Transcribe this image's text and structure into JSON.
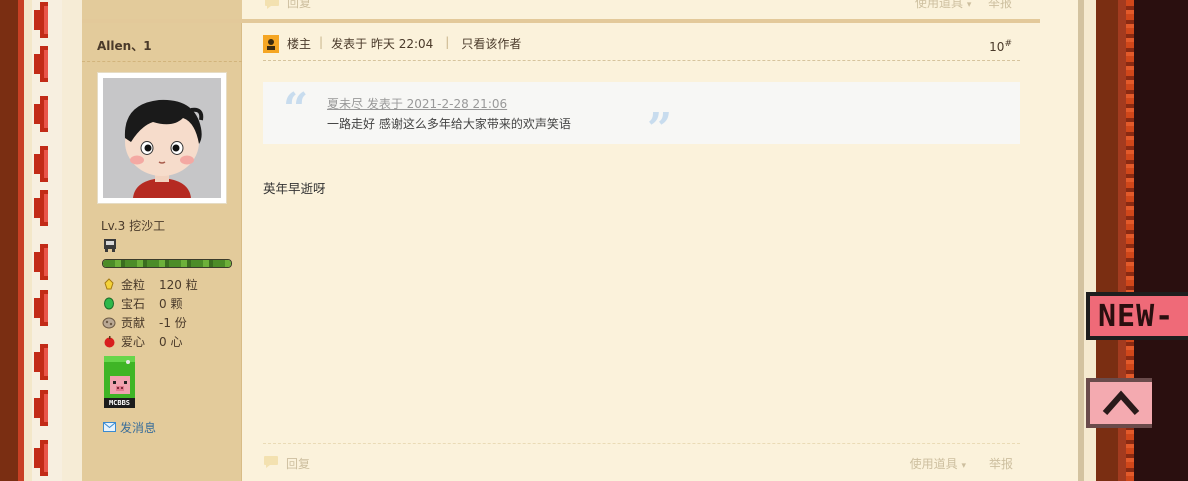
{
  "top_bar": {
    "reply_label": "回复",
    "tools_label": "使用道具",
    "report_label": "举报"
  },
  "author": {
    "username": "Allen、1",
    "level_text": "Lv.3 挖沙工",
    "exp_fraction": 1.0,
    "stats": [
      {
        "icon": "gold-nugget-icon",
        "label": "金粒",
        "value": "120 粒"
      },
      {
        "icon": "emerald-icon",
        "label": "宝石",
        "value": "0 颗"
      },
      {
        "icon": "contribution-icon",
        "label": "贡献",
        "value": "-1 份"
      },
      {
        "icon": "apple-icon",
        "label": "爱心",
        "value": "0 心"
      }
    ],
    "badge_text": "MCBBS",
    "send_message_label": "发消息"
  },
  "post": {
    "author_role": "楼主",
    "posted_at": "发表于 昨天 22:04",
    "only_author_label": "只看该作者",
    "floor_number": "10",
    "floor_suffix": "#",
    "quote": {
      "meta": "夏未尽 发表于 2021-2-28 21:06",
      "text": "一路走好 感谢这么多年给大家带来的欢声笑语"
    },
    "body": "英年早逝呀",
    "footer": {
      "reply_label": "回复",
      "tools_label": "使用道具",
      "report_label": "举报"
    }
  },
  "side_tags": {
    "new_label": "NEW-"
  },
  "colors": {
    "page_background": "#fbf2db",
    "sidebar_background": "#e3cb9b",
    "accent_red": "#c22b17",
    "new_tag_pink": "#ef6a78"
  }
}
